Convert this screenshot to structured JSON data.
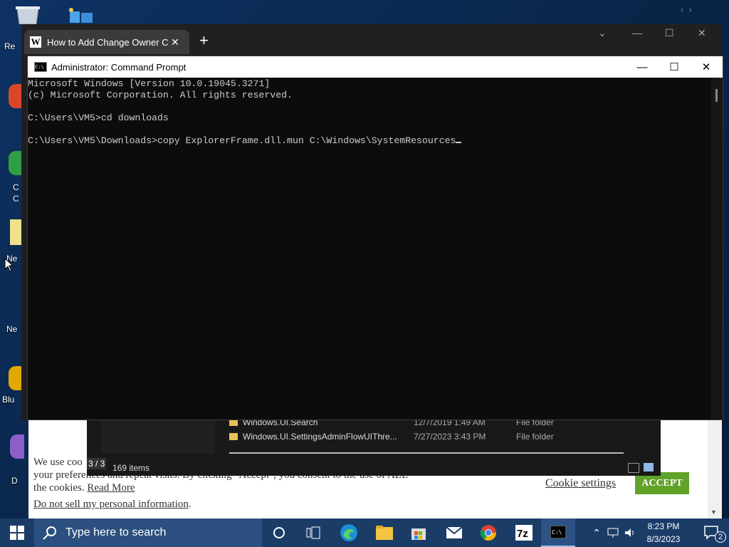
{
  "desktop": {
    "icon_labels": [
      "Re",
      "C",
      "C",
      "Ne",
      "Ne",
      "Blu",
      "D"
    ]
  },
  "browser": {
    "tab_title": "How to Add Change Owner Cont",
    "tab_favicon": "W",
    "close_tab": "✕",
    "new_tab": "+"
  },
  "cmd": {
    "title": "Administrator: Command Prompt",
    "lines": [
      "Microsoft Windows [Version 10.0.19045.3271]",
      "(c) Microsoft Corporation. All rights reserved.",
      "",
      "C:\\Users\\VM5>cd downloads",
      "",
      "C:\\Users\\VM5\\Downloads>copy ExplorerFrame.dll.mun C:\\Windows\\SystemResources"
    ]
  },
  "explorer": {
    "rows": [
      {
        "name": "Windows.UI.Search",
        "date": "12/7/2019 1:49 AM",
        "type": "File folder"
      },
      {
        "name": "Windows.UI.SettingsAdminFlowUIThre...",
        "date": "7/27/2023 3:43 PM",
        "type": "File folder"
      }
    ],
    "item_count": "169 items",
    "page_indicator": "3 / 3"
  },
  "cookie": {
    "text_line1": "We use coo",
    "text_line2": "your preferences and repeat visits. By clicking \"Accept\", you consent to the use of ALL",
    "text_line3": "the cookies.",
    "read_more": "Read More",
    "do_not_sell": "Do not sell my personal information",
    "settings": "Cookie settings",
    "accept": "ACCEPT"
  },
  "taskbar": {
    "search_placeholder": "Type here to search",
    "time": "8:23 PM",
    "date": "8/3/2023",
    "notification_count": "2",
    "apps": [
      "cortana-icon",
      "task-view-icon",
      "edge-icon",
      "file-explorer-icon",
      "store-icon",
      "mail-icon",
      "chrome-icon",
      "7zip-icon",
      "cmd-icon"
    ]
  },
  "colors": {
    "taskbar": "#1b3c67",
    "accept_button": "#61a229",
    "cmd_bg": "#0c0c0c",
    "cmd_text": "#cccccc"
  }
}
